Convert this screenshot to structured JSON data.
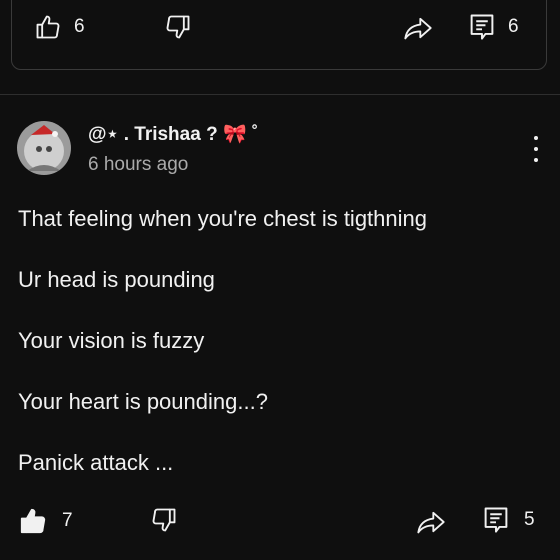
{
  "previous_comment": {
    "like_count": "6",
    "reply_count": "6"
  },
  "comment": {
    "author": "@⋆ . Trishaa ? 🎀 ˚",
    "timestamp": "6 hours ago",
    "lines": [
      "That feeling when you're chest is tigthning",
      "Ur head is pounding",
      "Your vision is fuzzy",
      "Your heart is pounding...?",
      "Panick attack ..."
    ],
    "like_count": "7",
    "liked": true,
    "reply_count": "5"
  },
  "icons": {
    "like": "thumbs-up-icon",
    "dislike": "thumbs-down-icon",
    "share": "share-icon",
    "reply": "comment-icon",
    "menu": "more-vertical-icon"
  },
  "colors": {
    "background": "#0f0f0f",
    "text": "#f1f1f1",
    "secondary_text": "#aaaaaa"
  }
}
